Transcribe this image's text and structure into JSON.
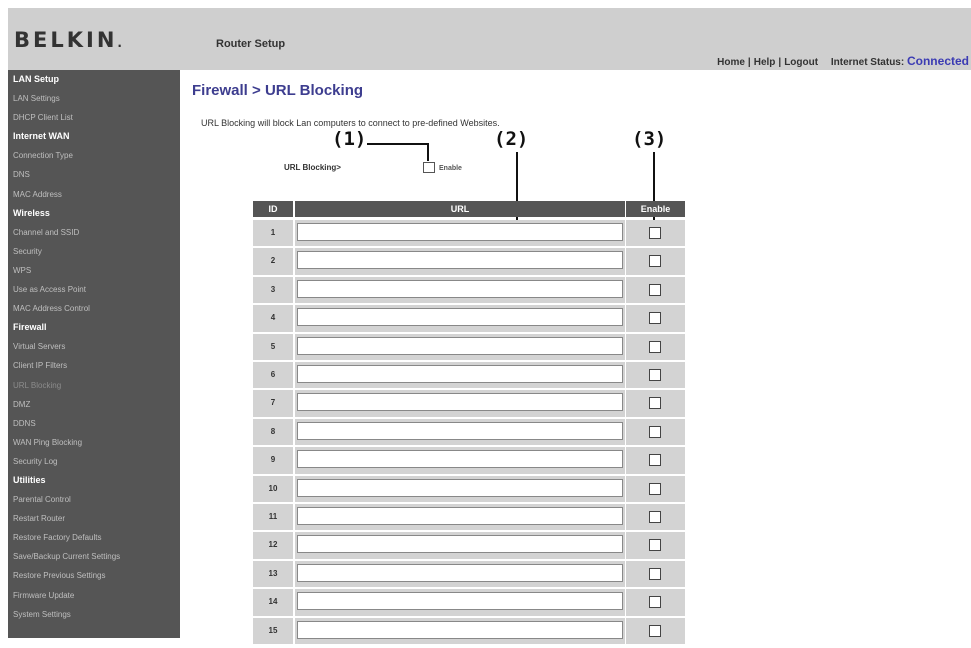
{
  "header": {
    "logo": "BELKIN",
    "logo_mark": ".",
    "app_title": "Router Setup",
    "links": {
      "home": "Home",
      "help": "Help",
      "logout": "Logout",
      "separator": "|"
    },
    "internet_status_label": "Internet Status:",
    "internet_status_value": "Connected"
  },
  "sidebar": {
    "sections": [
      {
        "title": "LAN Setup",
        "items": [
          "LAN Settings",
          "DHCP Client List"
        ]
      },
      {
        "title": "Internet WAN",
        "items": [
          "Connection Type",
          "DNS",
          "MAC Address"
        ]
      },
      {
        "title": "Wireless",
        "items": [
          "Channel and SSID",
          "Security",
          "WPS",
          "Use as Access Point",
          "MAC Address Control"
        ]
      },
      {
        "title": "Firewall",
        "items": [
          "Virtual Servers",
          "Client IP Filters",
          "URL Blocking",
          "DMZ",
          "DDNS",
          "WAN Ping Blocking",
          "Security Log"
        ]
      },
      {
        "title": "Utilities",
        "items": [
          "Parental Control",
          "Restart Router",
          "Restore Factory Defaults",
          "Save/Backup Current Settings",
          "Restore Previous Settings",
          "Firmware Update",
          "System Settings"
        ]
      }
    ],
    "active_item": "URL Blocking"
  },
  "main": {
    "title": "Firewall > URL Blocking",
    "description": "URL Blocking will block Lan computers to connect to pre-defined Websites.",
    "blocking_label": "URL Blocking>",
    "enable_label": "Enable",
    "callouts": [
      "(1)",
      "(2)",
      "(3)"
    ],
    "table": {
      "headers": {
        "id": "ID",
        "url": "URL",
        "enable": "Enable"
      },
      "rows": [
        {
          "id": "1",
          "url": ""
        },
        {
          "id": "2",
          "url": ""
        },
        {
          "id": "3",
          "url": ""
        },
        {
          "id": "4",
          "url": ""
        },
        {
          "id": "5",
          "url": ""
        },
        {
          "id": "6",
          "url": ""
        },
        {
          "id": "7",
          "url": ""
        },
        {
          "id": "8",
          "url": ""
        },
        {
          "id": "9",
          "url": ""
        },
        {
          "id": "10",
          "url": ""
        },
        {
          "id": "11",
          "url": ""
        },
        {
          "id": "12",
          "url": ""
        },
        {
          "id": "13",
          "url": ""
        },
        {
          "id": "14",
          "url": ""
        },
        {
          "id": "15",
          "url": ""
        }
      ]
    }
  },
  "colors": {
    "header_bg": "#cfcfcf",
    "sidebar_bg": "#555555",
    "title_color": "#3d3d8f",
    "status_connected": "#3b3bb3",
    "table_cell_bg": "#d3d3d3"
  }
}
